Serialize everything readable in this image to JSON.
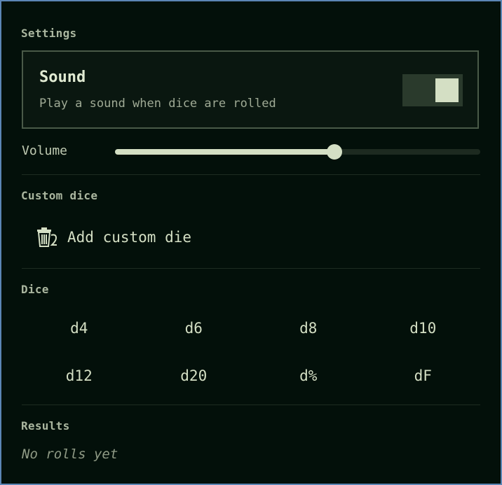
{
  "settings": {
    "label": "Settings"
  },
  "sound": {
    "title": "Sound",
    "description": "Play a sound when dice are rolled",
    "enabled": true
  },
  "volume": {
    "label": "Volume",
    "value_fraction": 0.6
  },
  "custom_dice": {
    "label": "Custom dice",
    "add_label": "Add custom die",
    "add_icon": "trash-icon"
  },
  "dice": {
    "label": "Dice",
    "items": [
      "d4",
      "d6",
      "d8",
      "d10",
      "d12",
      "d20",
      "d%",
      "dF"
    ]
  },
  "results": {
    "label": "Results",
    "empty_text": "No rolls yet"
  },
  "colors": {
    "accent": "#d4dfc4",
    "background": "#03100a",
    "frame_border": "#5b86b5"
  }
}
